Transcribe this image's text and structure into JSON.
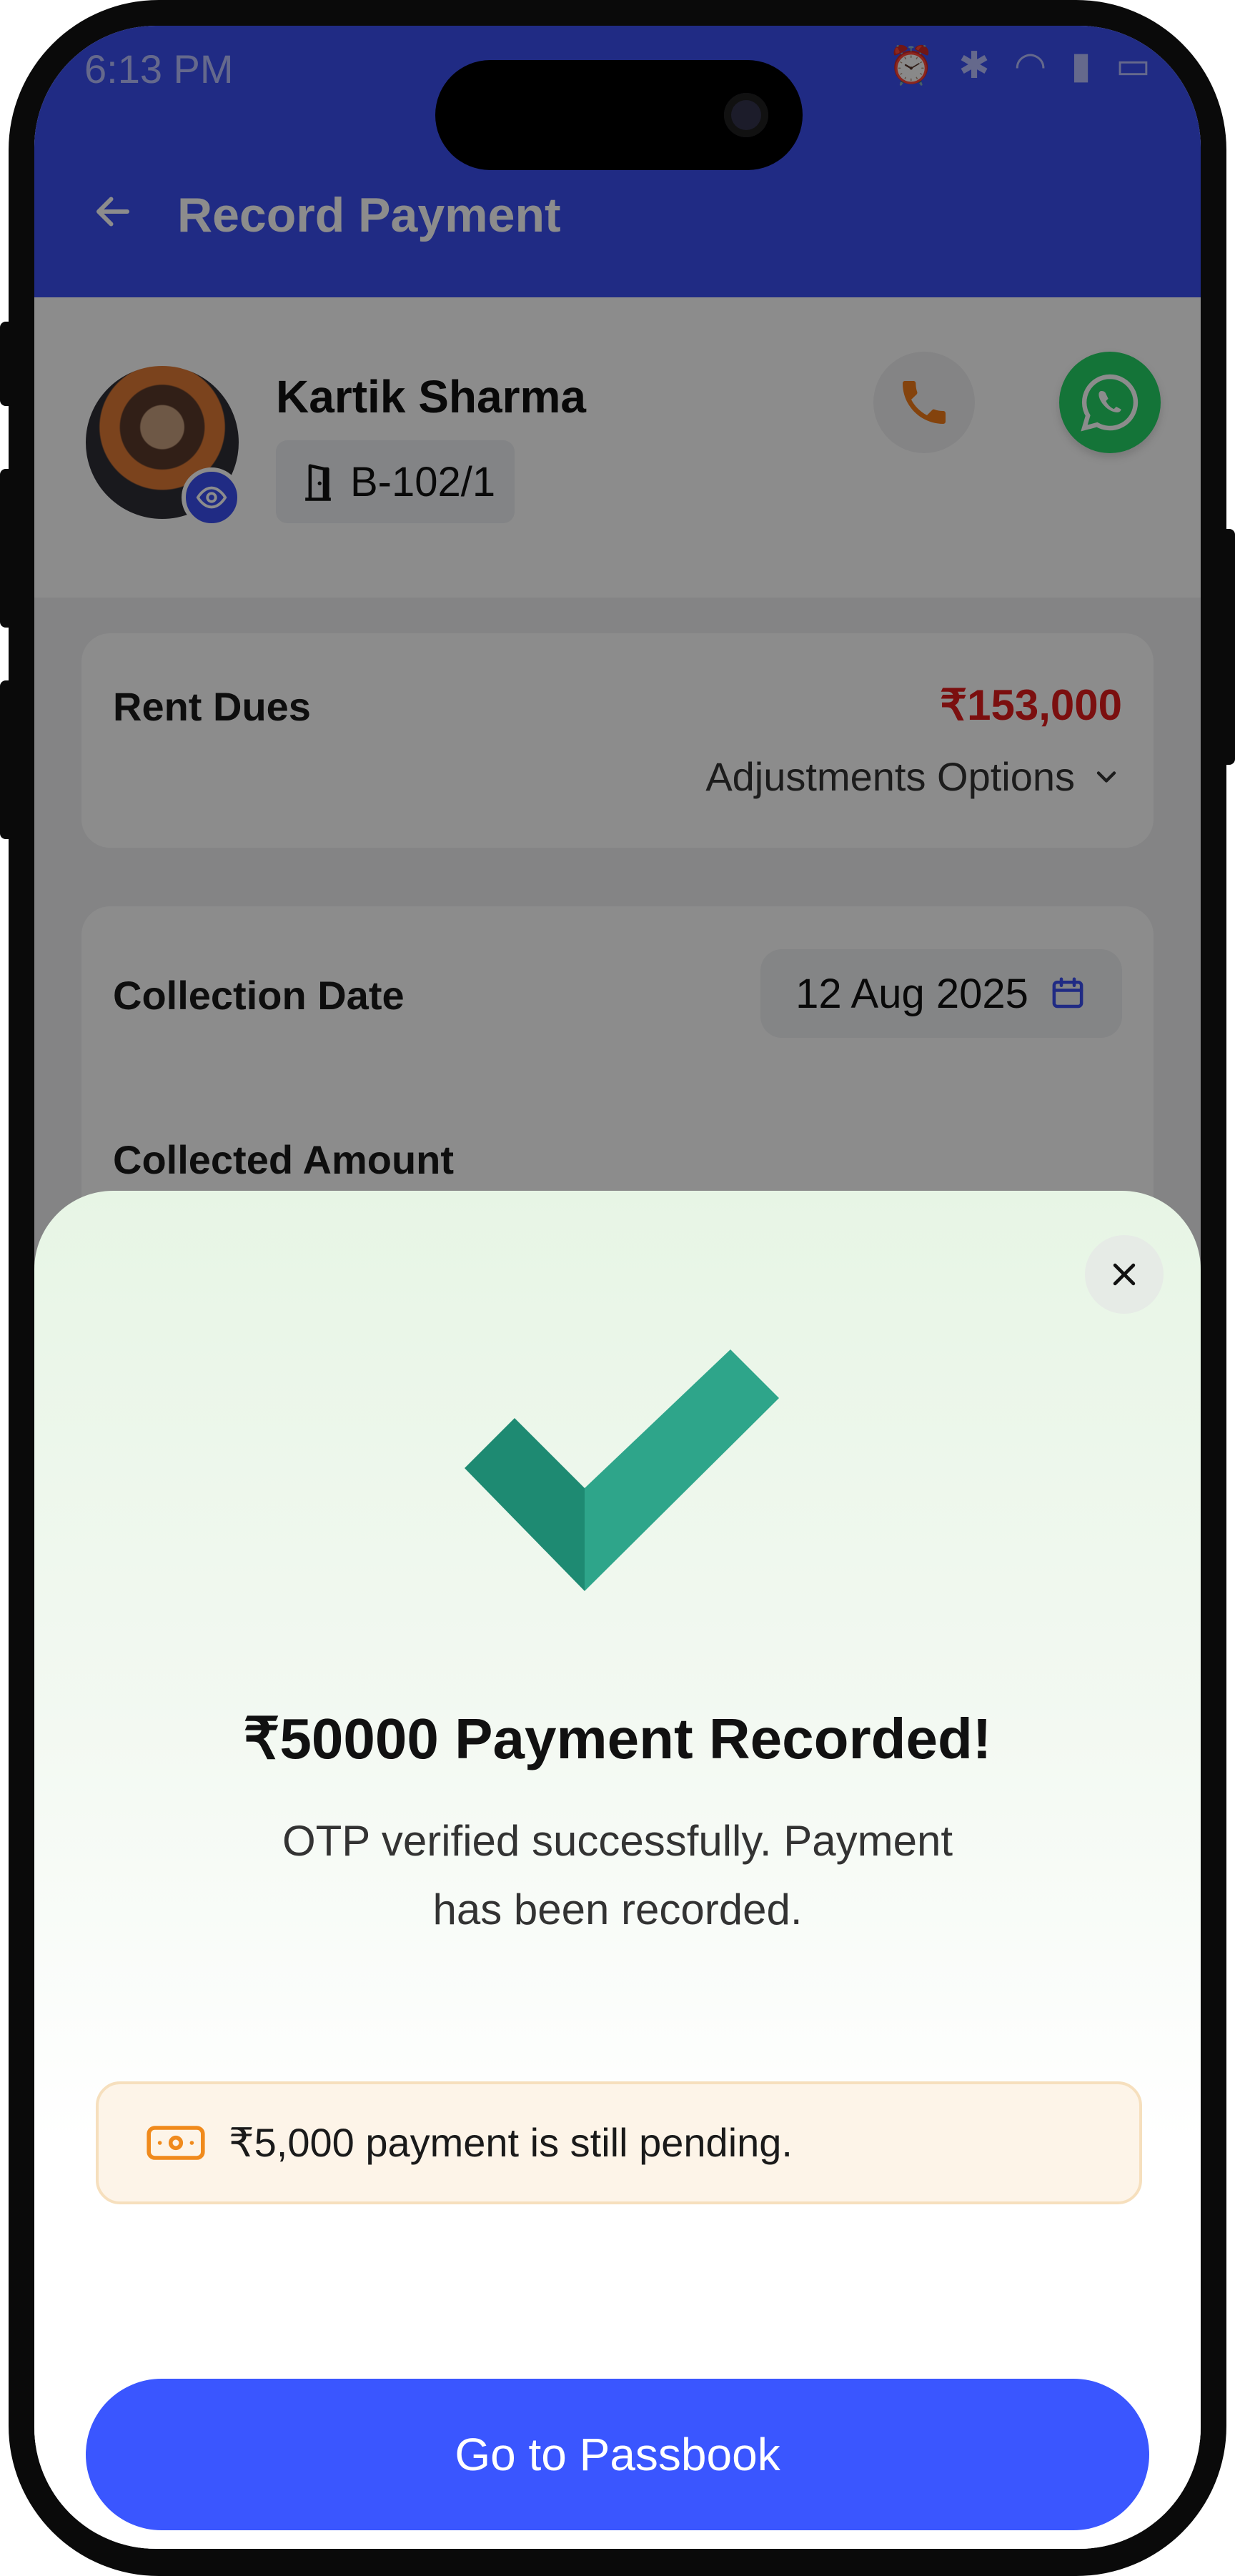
{
  "status_bar": {
    "time": "6:13 PM",
    "icons": [
      "alarm-icon",
      "bluetooth-icon",
      "wifi-icon",
      "signal-icon",
      "battery-icon"
    ]
  },
  "app_bar": {
    "title": "Record Payment",
    "back_icon": "arrow-left-icon"
  },
  "tenant": {
    "name": "Kartik Sharma",
    "room": "B-102/1"
  },
  "rent_card": {
    "label": "Rent Dues",
    "amount": "₹153,000",
    "adjustments_label": "Adjustments Options"
  },
  "collection_card": {
    "date_label": "Collection Date",
    "date_value": "12 Aug 2025",
    "amount_label": "Collected Amount"
  },
  "sheet": {
    "title": "₹50000 Payment Recorded!",
    "subtitle": "OTP verified successfully. Payment has been recorded.",
    "pending_text": "₹5,000 payment is still pending.",
    "cta_label": "Go to Passbook"
  },
  "colors": {
    "brand": "#3b4ff0",
    "cta": "#3a56ff",
    "due_red": "#e11d1d",
    "check_dark": "#1e8a72",
    "check_light": "#2ea58a",
    "pending_bg": "#fdf4e8",
    "pending_icon": "#f08a1c"
  }
}
